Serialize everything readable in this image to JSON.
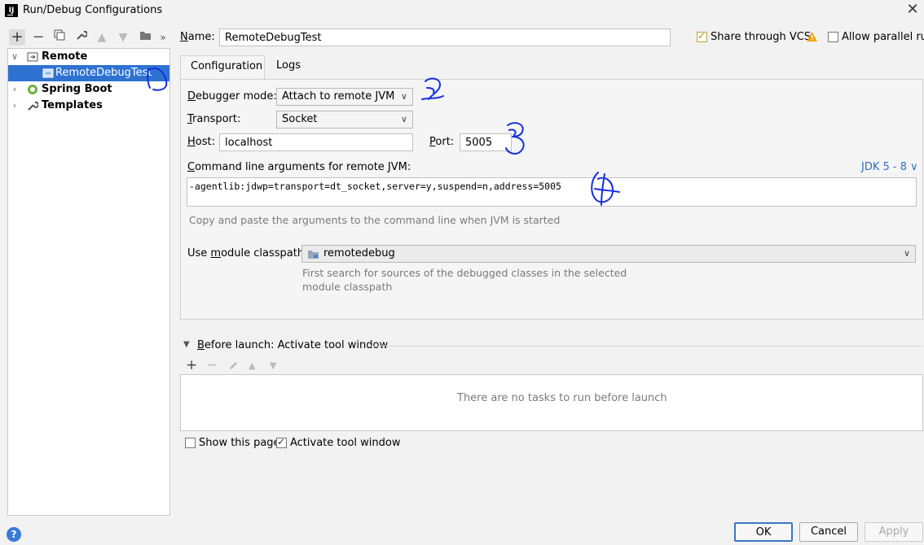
{
  "window": {
    "title": "Run/Debug Configurations",
    "app_icon_text": "IJ"
  },
  "toolbar": {
    "icons": [
      "plus-icon",
      "minus-icon",
      "copy-icon",
      "wrench-icon",
      "arrow-up-icon",
      "arrow-down-icon",
      "folder-icon",
      "more-icon"
    ]
  },
  "tree": {
    "items": [
      {
        "label": "Remote",
        "expanded": true
      },
      {
        "label": "RemoteDebugTest",
        "selected": true
      },
      {
        "label": "Spring Boot",
        "expanded": false
      },
      {
        "label": "Templates",
        "expanded": false
      }
    ]
  },
  "name": {
    "label": "Name:",
    "value": "RemoteDebugTest"
  },
  "share": {
    "label": "Share through VCS",
    "checked": true
  },
  "parallel": {
    "label": "Allow parallel run",
    "checked": false
  },
  "tabs": [
    {
      "label": "Configuration",
      "active": true
    },
    {
      "label": "Logs",
      "active": false
    }
  ],
  "config": {
    "debugger_mode_label": "Debugger mode:",
    "debugger_mode_value": "Attach to remote JVM",
    "transport_label": "Transport:",
    "transport_value": "Socket",
    "host_label": "Host:",
    "host_value": "localhost",
    "port_label": "Port:",
    "port_value": "5005",
    "cmd_label": "Command line arguments for remote JVM:",
    "jdk_link": "JDK 5 - 8",
    "cmd_value": "-agentlib:jdwp=transport=dt_socket,server=y,suspend=n,address=5005",
    "cmd_hint": "Copy and paste the arguments to the command line when JVM is started",
    "module_label": "Use module classpath:",
    "module_value": "remotedebug",
    "module_hint_1": "First search for sources of the debugged classes in the selected",
    "module_hint_2": "module classpath"
  },
  "before_launch": {
    "label": "Before launch: Activate tool window",
    "empty_text": "There are no tasks to run before launch"
  },
  "show_page": {
    "label": "Show this page",
    "checked": false
  },
  "activate_tool": {
    "label": "Activate tool window",
    "checked": true
  },
  "buttons": {
    "ok": "OK",
    "cancel": "Cancel",
    "apply": "Apply",
    "help": "?"
  },
  "colors": {
    "selection": "#2e72d1",
    "link": "#2f6fbf",
    "warning": "#f0a30a",
    "ink": "#1530e0"
  }
}
